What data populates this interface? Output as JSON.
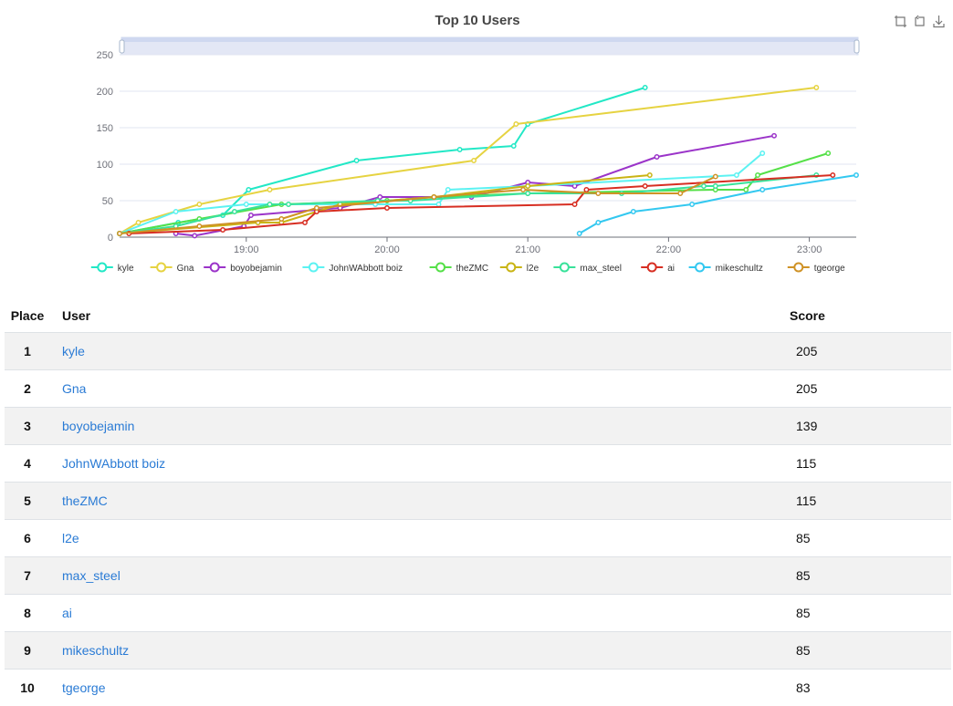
{
  "chart_data": {
    "type": "line",
    "title": "Top 10 Users",
    "xlabel": "",
    "ylabel": "",
    "x_type": "time",
    "x_range": [
      "18:06",
      "23:20"
    ],
    "x_ticks": [
      "19:00",
      "20:00",
      "21:00",
      "22:00",
      "23:00"
    ],
    "ylim": [
      0,
      250
    ],
    "y_ticks": [
      0,
      50,
      100,
      150,
      200,
      250
    ],
    "grid": "horizontal",
    "legend_position": "bottom",
    "series": [
      {
        "name": "kyle",
        "color": "#22e8c6",
        "points": [
          [
            "18:06",
            5
          ],
          [
            "18:31",
            20
          ],
          [
            "18:50",
            30
          ],
          [
            "19:01",
            65
          ],
          [
            "19:47",
            105
          ],
          [
            "20:31",
            120
          ],
          [
            "20:54",
            125
          ],
          [
            "21:00",
            155
          ],
          [
            "21:50",
            205
          ]
        ]
      },
      {
        "name": "Gna",
        "color": "#e6d341",
        "points": [
          [
            "18:06",
            5
          ],
          [
            "18:14",
            20
          ],
          [
            "18:40",
            45
          ],
          [
            "19:10",
            65
          ],
          [
            "20:37",
            105
          ],
          [
            "20:55",
            155
          ],
          [
            "23:03",
            205
          ]
        ]
      },
      {
        "name": "boyobejamin",
        "color": "#9b34c9",
        "points": [
          [
            "18:30",
            5
          ],
          [
            "18:38",
            2
          ],
          [
            "18:59",
            15
          ],
          [
            "19:02",
            30
          ],
          [
            "19:40",
            40
          ],
          [
            "19:57",
            55
          ],
          [
            "20:36",
            55
          ],
          [
            "21:00",
            75
          ],
          [
            "21:20",
            70
          ],
          [
            "21:55",
            110
          ],
          [
            "22:45",
            139
          ]
        ]
      },
      {
        "name": "JohnWAbbott boiz",
        "color": "#5cf2f2",
        "points": [
          [
            "18:06",
            5
          ],
          [
            "18:30",
            35
          ],
          [
            "19:00",
            45
          ],
          [
            "19:55",
            45
          ],
          [
            "20:22",
            45
          ],
          [
            "20:26",
            65
          ],
          [
            "21:00",
            70
          ],
          [
            "22:29",
            85
          ],
          [
            "22:40",
            115
          ]
        ]
      },
      {
        "name": "theZMC",
        "color": "#55e048",
        "points": [
          [
            "18:06",
            5
          ],
          [
            "18:40",
            25
          ],
          [
            "19:15",
            45
          ],
          [
            "20:00",
            50
          ],
          [
            "20:20",
            55
          ],
          [
            "21:00",
            60
          ],
          [
            "22:20",
            65
          ],
          [
            "22:33",
            65
          ],
          [
            "22:38",
            85
          ],
          [
            "23:08",
            115
          ]
        ]
      },
      {
        "name": "l2e",
        "color": "#c9b414",
        "points": [
          [
            "18:06",
            5
          ],
          [
            "19:05",
            20
          ],
          [
            "19:15",
            20
          ],
          [
            "19:40",
            45
          ],
          [
            "20:20",
            55
          ],
          [
            "21:00",
            70
          ],
          [
            "21:52",
            85
          ]
        ]
      },
      {
        "name": "max_steel",
        "color": "#38e29a",
        "points": [
          [
            "18:06",
            5
          ],
          [
            "18:30",
            15
          ],
          [
            "18:55",
            35
          ],
          [
            "19:10",
            45
          ],
          [
            "19:18",
            45
          ],
          [
            "19:56",
            50
          ],
          [
            "20:10",
            50
          ],
          [
            "21:00",
            60
          ],
          [
            "21:40",
            60
          ],
          [
            "22:15",
            70
          ],
          [
            "22:20",
            70
          ],
          [
            "23:03",
            85
          ]
        ]
      },
      {
        "name": "ai",
        "color": "#d72e22",
        "points": [
          [
            "18:10",
            5
          ],
          [
            "18:50",
            10
          ],
          [
            "19:25",
            20
          ],
          [
            "19:30",
            35
          ],
          [
            "20:00",
            40
          ],
          [
            "21:20",
            45
          ],
          [
            "21:25",
            65
          ],
          [
            "21:50",
            70
          ],
          [
            "23:10",
            85
          ]
        ]
      },
      {
        "name": "mikeschultz",
        "color": "#33c8f0",
        "points": [
          [
            "21:22",
            5
          ],
          [
            "21:30",
            20
          ],
          [
            "21:45",
            35
          ],
          [
            "22:10",
            45
          ],
          [
            "22:40",
            65
          ],
          [
            "23:20",
            85
          ]
        ]
      },
      {
        "name": "tgeorge",
        "color": "#cf9226",
        "points": [
          [
            "18:06",
            5
          ],
          [
            "18:40",
            15
          ],
          [
            "19:15",
            25
          ],
          [
            "19:30",
            40
          ],
          [
            "20:20",
            55
          ],
          [
            "20:58",
            65
          ],
          [
            "21:30",
            60
          ],
          [
            "22:05",
            60
          ],
          [
            "22:20",
            83
          ]
        ]
      }
    ]
  },
  "toolbox": {
    "icons": [
      "zoom-icon",
      "zoom-reset-icon",
      "download-icon"
    ]
  },
  "table": {
    "headers": {
      "place": "Place",
      "user": "User",
      "score": "Score"
    },
    "rows": [
      {
        "place": "1",
        "user": "kyle",
        "score": "205"
      },
      {
        "place": "2",
        "user": "Gna",
        "score": "205"
      },
      {
        "place": "3",
        "user": "boyobejamin",
        "score": "139"
      },
      {
        "place": "4",
        "user": "JohnWAbbott boiz",
        "score": "115"
      },
      {
        "place": "5",
        "user": "theZMC",
        "score": "115"
      },
      {
        "place": "6",
        "user": "l2e",
        "score": "85"
      },
      {
        "place": "7",
        "user": "max_steel",
        "score": "85"
      },
      {
        "place": "8",
        "user": "ai",
        "score": "85"
      },
      {
        "place": "9",
        "user": "mikeschultz",
        "score": "85"
      },
      {
        "place": "10",
        "user": "tgeorge",
        "score": "83"
      }
    ]
  }
}
